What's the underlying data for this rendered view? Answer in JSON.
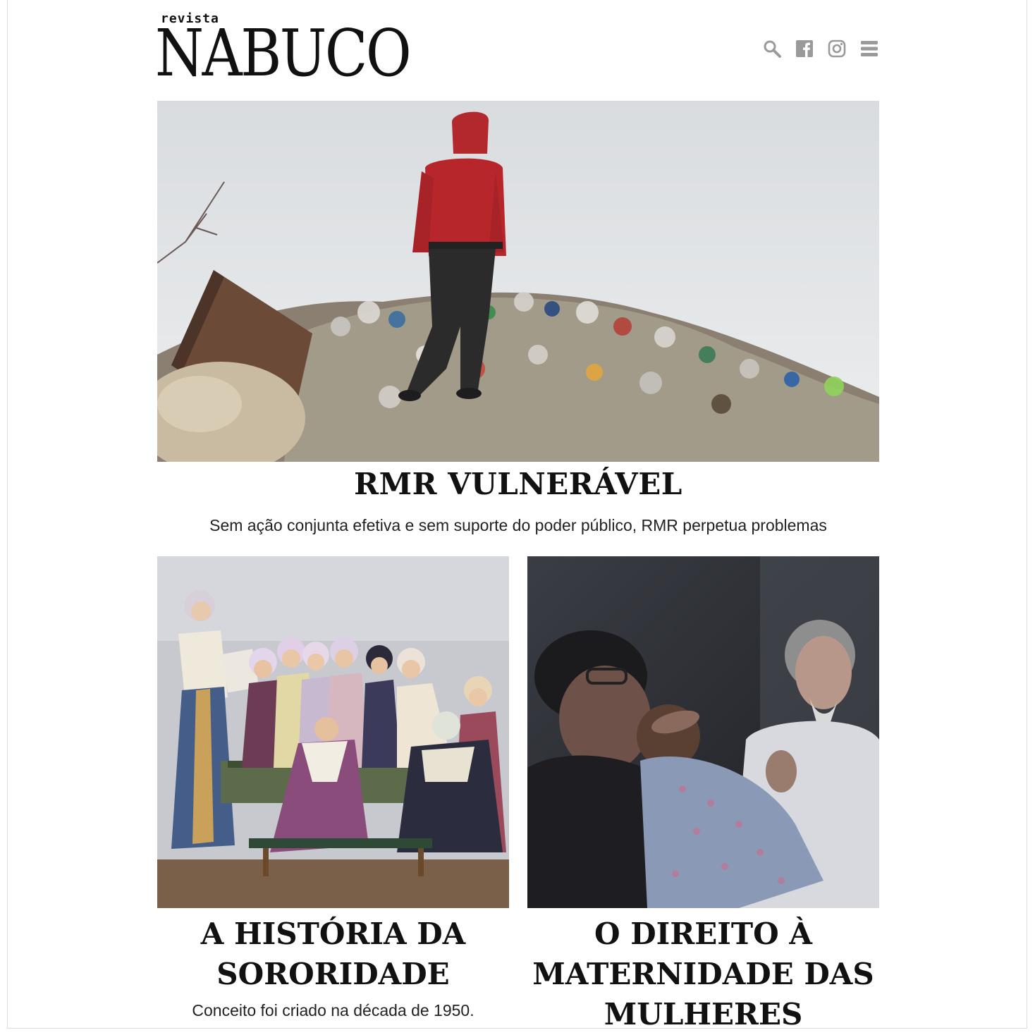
{
  "header": {
    "logo_small": "revista",
    "logo_big": "NABUCO",
    "icons": [
      "search-icon",
      "facebook-icon",
      "instagram-icon",
      "menu-icon"
    ]
  },
  "featured": {
    "title": "RMR VULNERÁVEL",
    "subtitle": "Sem ação conjunta efetiva e sem suporte do poder público, RMR perpetua problemas"
  },
  "articles": [
    {
      "title_line1": "A HISTÓRIA DA",
      "title_line2": "SORORIDADE",
      "subtitle": "Conceito foi criado na década de 1950."
    },
    {
      "title_line1": "O DIREITO À",
      "title_line2": "MATERNIDADE DAS",
      "title_line3": "MULHERES"
    }
  ],
  "colors": {
    "text": "#111111",
    "icon_gray": "#9a9a9a"
  }
}
